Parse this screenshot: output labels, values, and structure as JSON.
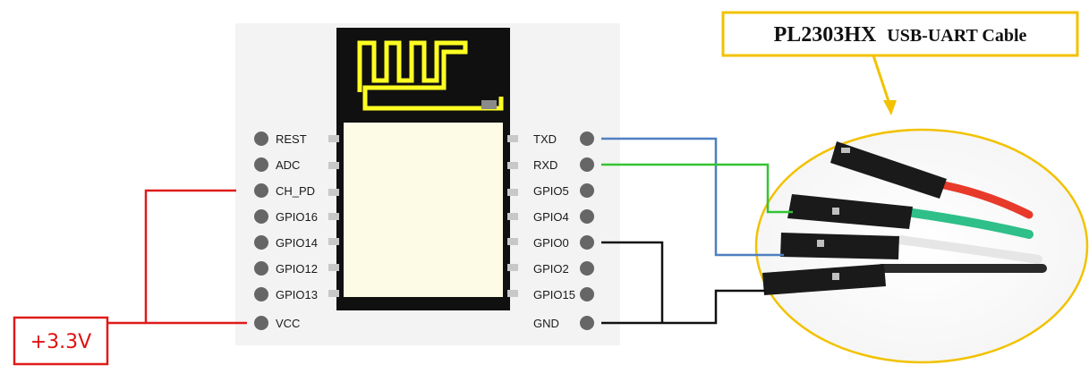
{
  "module": {
    "left_pins": [
      {
        "label": "REST"
      },
      {
        "label": "ADC"
      },
      {
        "label": "CH_PD"
      },
      {
        "label": "GPIO16"
      },
      {
        "label": "GPIO14"
      },
      {
        "label": "GPIO12"
      },
      {
        "label": "GPIO13"
      },
      {
        "label": "VCC"
      }
    ],
    "right_pins": [
      {
        "label": "TXD"
      },
      {
        "label": "RXD"
      },
      {
        "label": "GPIO5"
      },
      {
        "label": "GPIO4"
      },
      {
        "label": "GPIO0"
      },
      {
        "label": "GPIO2"
      },
      {
        "label": "GPIO15"
      },
      {
        "label": "GND"
      }
    ]
  },
  "cable_callout": {
    "title_main": "PL2303HX",
    "title_sub": "USB-UART Cable"
  },
  "power_supply": {
    "label": "+3.3V"
  },
  "colors": {
    "power_wire": "#e01a1a",
    "txd_wire": "#4f7fc0",
    "rxd_wire": "#33c433",
    "ground_wire": "#111111",
    "antenna": "#ffff22",
    "callout_border": "#f2c200",
    "board": "#f3f3f3",
    "shield": "#fdfbe6"
  }
}
